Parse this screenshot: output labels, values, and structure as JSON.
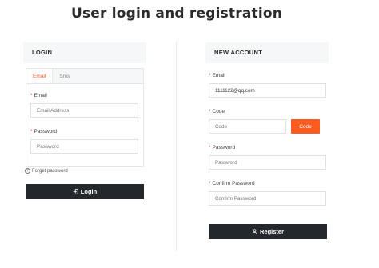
{
  "page": {
    "title": "User login and registration"
  },
  "login": {
    "header": "LOGIN",
    "tabs": [
      {
        "label": "Email",
        "active": true
      },
      {
        "label": "Sms",
        "active": false
      }
    ],
    "email": {
      "label": "Email",
      "placeholder": "Email Address"
    },
    "password": {
      "label": "Password",
      "placeholder": "Password"
    },
    "forget_label": "Forget password",
    "submit_label": "Login"
  },
  "account": {
    "header": "NEW ACCOUNT",
    "email": {
      "label": "Email",
      "value": "1111122@qq.com"
    },
    "code": {
      "label": "Code",
      "placeholder": "Code",
      "button_label": "Code"
    },
    "password": {
      "label": "Password",
      "placeholder": "Password"
    },
    "confirm": {
      "label": "Confirm Password",
      "placeholder": "Confirm Password"
    },
    "submit_label": "Register"
  },
  "colors": {
    "accent": "#ff5a1f",
    "dark": "#24272c",
    "required": "#e53935"
  }
}
